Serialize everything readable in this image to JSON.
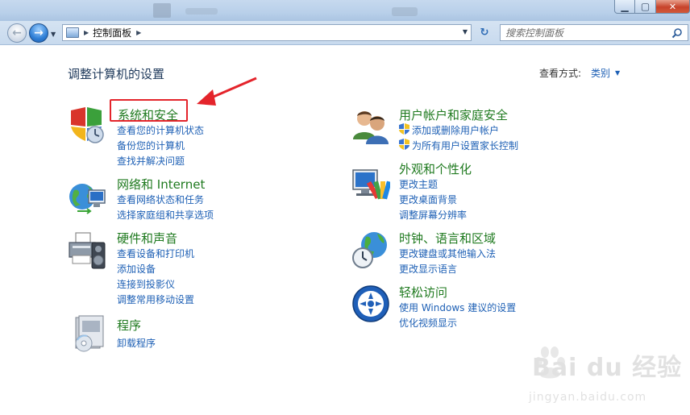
{
  "window": {
    "minimize_glyph": "▁",
    "maximize_glyph": "▢",
    "close_glyph": "✕"
  },
  "nav": {
    "back_glyph": "←",
    "forward_glyph": "→",
    "dropdown_glyph": "▼",
    "refresh_glyph": "↻"
  },
  "address": {
    "separator": "▶",
    "location": "控制面板",
    "trailing_separator": "▶",
    "dropdown_glyph": "▼"
  },
  "search": {
    "placeholder": "搜索控制面板"
  },
  "header": {
    "title": "调整计算机的设置",
    "view_by_label": "查看方式:",
    "view_by_value": "类别",
    "view_by_arrow": "▼"
  },
  "left_categories": [
    {
      "icon": "shield-clock-icon",
      "title": "系统和安全",
      "links": [
        "查看您的计算机状态",
        "备份您的计算机",
        "查找并解决问题"
      ]
    },
    {
      "icon": "network-globe-icon",
      "title": "网络和 Internet",
      "links": [
        "查看网络状态和任务",
        "选择家庭组和共享选项"
      ]
    },
    {
      "icon": "printer-speaker-icon",
      "title": "硬件和声音",
      "links": [
        "查看设备和打印机",
        "添加设备",
        "连接到投影仪",
        "调整常用移动设置"
      ]
    },
    {
      "icon": "programs-cd-icon",
      "title": "程序",
      "links": [
        "卸载程序"
      ]
    }
  ],
  "right_categories": [
    {
      "icon": "users-icon",
      "title": "用户帐户和家庭安全",
      "links": [
        "添加或删除用户帐户",
        "为所有用户设置家长控制"
      ]
    },
    {
      "icon": "monitor-palette-icon",
      "title": "外观和个性化",
      "links": [
        "更改主题",
        "更改桌面背景",
        "调整屏幕分辨率"
      ]
    },
    {
      "icon": "clock-globe-icon",
      "title": "时钟、语言和区域",
      "links": [
        "更改键盘或其他输入法",
        "更改显示语言"
      ]
    },
    {
      "icon": "ease-of-access-icon",
      "title": "轻松访问",
      "links": [
        "使用 Windows 建议的设置",
        "优化视频显示"
      ]
    }
  ],
  "watermark": {
    "text": "Bai du 经验",
    "url": "jingyan.baidu.com"
  },
  "colors": {
    "category_title": "#1f7a1f",
    "link": "#1e60b5",
    "page_title": "#1e395b",
    "highlight_box": "#e4242b"
  }
}
